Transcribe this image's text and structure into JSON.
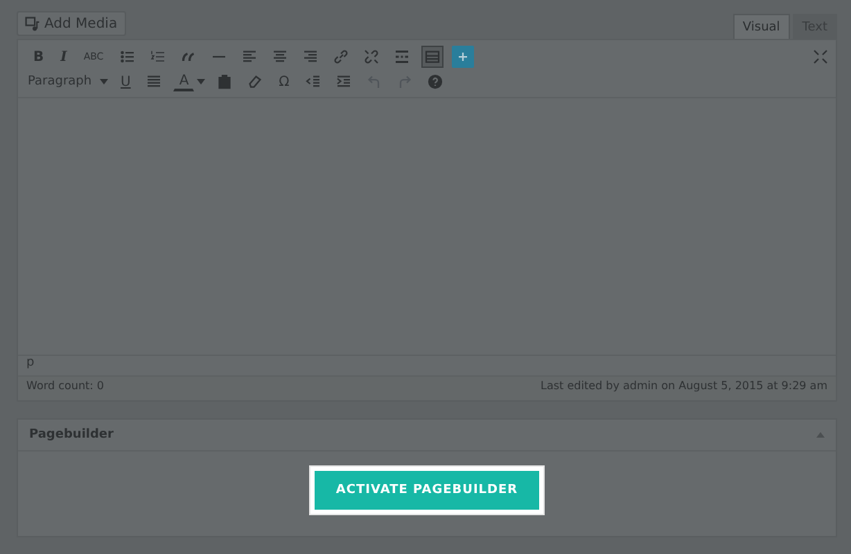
{
  "add_media_button": {
    "label": "Add Media"
  },
  "editor_tabs": [
    {
      "label": "Visual",
      "selected": true
    },
    {
      "label": "Text",
      "selected": false
    }
  ],
  "toolbar_rows": [
    [
      {
        "kind": "bold",
        "text": "B",
        "on": false
      },
      {
        "kind": "italic",
        "text": "I",
        "on": false
      },
      {
        "kind": "strike",
        "text": "ABC",
        "on": false
      },
      {
        "kind": "bullet-list",
        "on": false
      },
      {
        "kind": "number-list",
        "on": false
      },
      {
        "kind": "quote",
        "on": false
      },
      {
        "kind": "rule",
        "on": false
      },
      {
        "kind": "align-left",
        "on": false
      },
      {
        "kind": "align-center",
        "on": false
      },
      {
        "kind": "align-right",
        "on": false
      },
      {
        "kind": "link",
        "on": false
      },
      {
        "kind": "unlink",
        "on": false
      },
      {
        "kind": "more",
        "on": false
      },
      {
        "kind": "toolbar-toggle",
        "on": true
      },
      {
        "kind": "plus",
        "on": false
      }
    ],
    [
      {
        "kind": "select",
        "text": "Paragraph"
      },
      {
        "kind": "underline",
        "text": "U",
        "on": false
      },
      {
        "kind": "justify",
        "on": false
      },
      {
        "kind": "color",
        "text": "A",
        "on": false
      },
      {
        "kind": "paste",
        "on": false
      },
      {
        "kind": "eraser",
        "on": false
      },
      {
        "kind": "omega",
        "text": "Ω",
        "on": false
      },
      {
        "kind": "outdent",
        "on": false
      },
      {
        "kind": "indent",
        "on": false
      },
      {
        "kind": "undo",
        "on": false
      },
      {
        "kind": "redo",
        "on": false
      },
      {
        "kind": "help",
        "on": false
      }
    ]
  ],
  "path": "p",
  "word_count": "Word count: 0",
  "last_edited": "Last edited by admin on August 5, 2015 at 9:29 am",
  "pagebuilder": {
    "title": "Pagebuilder",
    "expanded": true,
    "button": "ACTIVATE PAGEBUILDER"
  }
}
